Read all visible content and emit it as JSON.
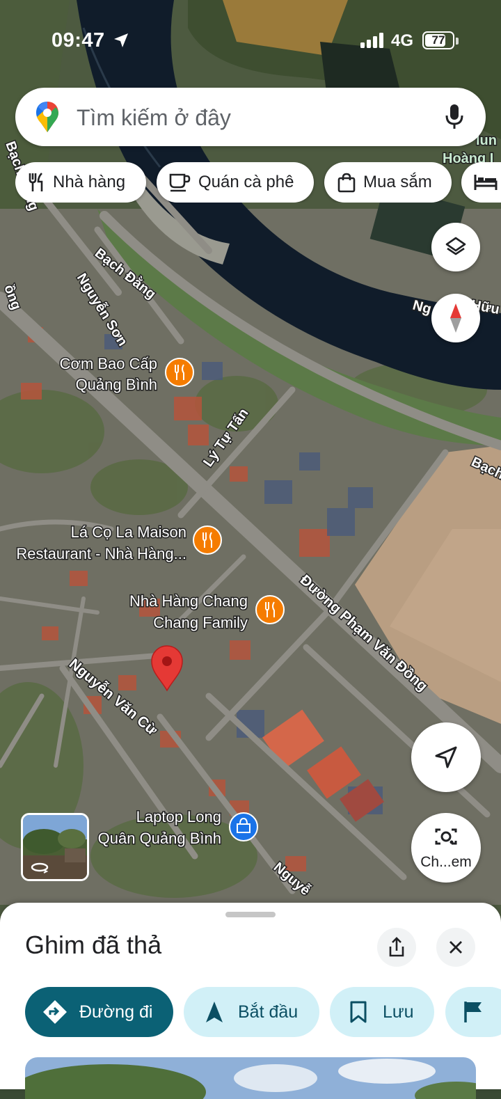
{
  "status_bar": {
    "time": "09:47",
    "network": "4G",
    "battery": "77",
    "battery_level": 0.77
  },
  "search": {
    "placeholder": "Tìm kiếm ở đây"
  },
  "chips": [
    {
      "label": "Nhà hàng",
      "icon": "fork-knife-icon"
    },
    {
      "label": "Quán cà phê",
      "icon": "coffee-cup-icon"
    },
    {
      "label": "Mua sắm",
      "icon": "shopping-bag-icon"
    },
    {
      "label": "",
      "icon": "bed-icon"
    }
  ],
  "map": {
    "street_labels": [
      "Bạch Đằng",
      "Bạch Đằng",
      "Bạch",
      "Nguyễn Sơn",
      "Lý Tự Tấn",
      "Đường Phạm Văn Đồng",
      "Nguyễn Văn Cừ",
      "Nguyễ",
      "Ng",
      "Hữu T",
      "ồng",
      "Hoàng I",
      "lun"
    ],
    "places": [
      {
        "name": "Cơm Bao Cấp Quảng Bình",
        "line1": "Cơm Bao Cấp",
        "line2": "Quảng Bình",
        "icon": "restaurant-pin-icon"
      },
      {
        "name": "Lá Cọ La Maison Restaurant - Nhà Hàng...",
        "line1": "Lá Cọ La Maison",
        "line2": "Restaurant - Nhà Hàng...",
        "icon": "restaurant-pin-icon"
      },
      {
        "name": "Nhà Hàng Chang Chang Family",
        "line1": "Nhà Hàng Chang",
        "line2": "Chang Family",
        "icon": "restaurant-pin-icon"
      },
      {
        "name": "Laptop Long Quân Quảng Bình",
        "line1": "Laptop Long",
        "line2": "Quân Quảng Bình",
        "icon": "shopping-pin-icon"
      }
    ],
    "dropped_pin_color": "#e53935"
  },
  "controls": {
    "layers_icon": "layers-icon",
    "compass_icon": "compass-icon",
    "location_icon": "navigation-arrow-icon",
    "lens_label": "Ch...em"
  },
  "sheet": {
    "title": "Ghim đã thả",
    "actions": [
      {
        "label": "Đường đi",
        "icon": "directions-icon",
        "primary": true
      },
      {
        "label": "Bắt đầu",
        "icon": "navigation-icon",
        "primary": false
      },
      {
        "label": "Lưu",
        "icon": "bookmark-icon",
        "primary": false
      },
      {
        "label": "",
        "icon": "flag-icon",
        "primary": false
      }
    ]
  },
  "colors": {
    "primary_action": "#0b6175",
    "secondary_action": "#d1f0f7",
    "restaurant_pin": "#f57c00",
    "shopping_pin": "#1a73e8"
  }
}
